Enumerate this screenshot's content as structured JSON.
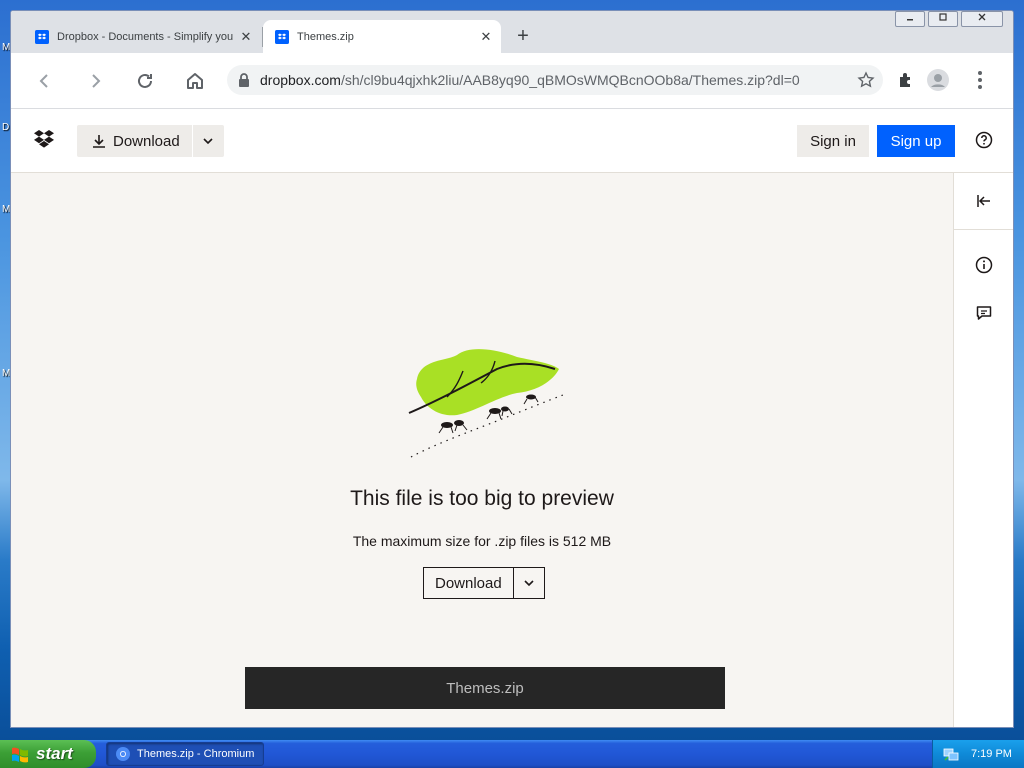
{
  "desktop": {
    "icon_letters": [
      "M",
      "D",
      "M",
      "M"
    ]
  },
  "browser": {
    "tabs": [
      {
        "title": "Dropbox - Documents - Simplify your",
        "active": false
      },
      {
        "title": "Themes.zip",
        "active": true
      }
    ],
    "new_tab_symbol": "+",
    "close_symbol": "✕",
    "window_controls": [
      "minimize",
      "restore",
      "close"
    ],
    "url_host": "dropbox.com",
    "url_path": "/sh/cl9bu4qjxhk2liu/AAB8yq90_qBMOsWMQBcnOOb8a/Themes.zip?dl=0",
    "icons": [
      "back-icon",
      "forward-icon",
      "reload-icon",
      "home-icon",
      "lock-icon",
      "star-icon",
      "extensions-icon",
      "profile-icon",
      "menu-icon"
    ]
  },
  "page": {
    "header": {
      "download_label": "Download",
      "signin_label": "Sign in",
      "signup_label": "Sign up"
    },
    "preview": {
      "title": "This file is too big to preview",
      "subtitle": "The maximum size for .zip files is 512 MB",
      "download_label": "Download",
      "filename": "Themes.zip"
    },
    "colors": {
      "accent": "#0061fe",
      "leaf": "#a9e025",
      "background": "#f7f5f2"
    }
  },
  "taskbar": {
    "start_label": "start",
    "task_label": "Themes.zip - Chromium",
    "clock": "7:19 PM"
  }
}
